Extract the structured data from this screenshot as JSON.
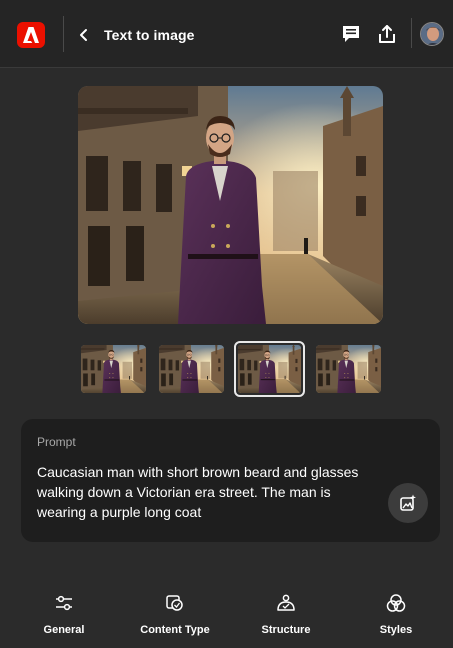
{
  "header": {
    "title": "Text to image",
    "logo_icon": "adobe-logo",
    "back_icon": "chevron-left-icon",
    "feedback_icon": "feedback-icon",
    "share_icon": "share-icon",
    "brand_color": "#eb1000"
  },
  "prompt": {
    "label": "Prompt",
    "text": "Caucasian man with short brown beard and glasses walking down a Victorian era street. The man is wearing a purple long coat",
    "action_icon": "generate-similar-icon"
  },
  "thumbnails": {
    "count": 4,
    "selected_index": 2
  },
  "nav": {
    "items": [
      {
        "label": "General",
        "icon": "sliders-icon"
      },
      {
        "label": "Content Type",
        "icon": "content-type-icon"
      },
      {
        "label": "Structure",
        "icon": "structure-icon"
      },
      {
        "label": "Styles",
        "icon": "styles-icon"
      }
    ]
  }
}
